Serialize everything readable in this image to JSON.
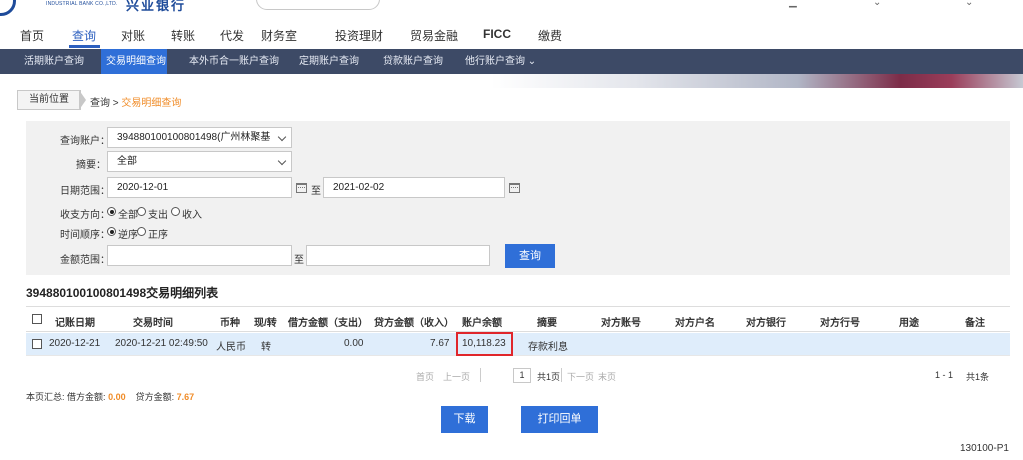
{
  "header": {
    "bank_name_en": "INDUSTRIAL BANK CO.,LTD.",
    "bank_name_cn": "兴业银行",
    "top_icons": [
      "user-icon",
      "chevron-down-icon",
      "help-icon"
    ]
  },
  "main_nav": {
    "items": [
      "首页",
      "查询",
      "对账",
      "转账",
      "代发",
      "财务室",
      "投资理财",
      "贸易金融",
      "FICC",
      "缴费"
    ],
    "active": "查询"
  },
  "sub_nav": {
    "items": [
      "活期账户查询",
      "交易明细查询",
      "本外币合一账户查询",
      "定期账户查询",
      "贷款账户查询",
      "他行账户查询"
    ],
    "active": "交易明细查询"
  },
  "breadcrumb": {
    "label": "当前位置",
    "path": "查询 > ",
    "current": "交易明细查询"
  },
  "query": {
    "account_label": "查询账户：",
    "account_value": "394880100100801498(广州林聚基",
    "summary_label": "摘要：",
    "summary_value": "全部",
    "date_label": "日期范围：",
    "date_from": "2020-12-01",
    "date_to_sep": "至",
    "date_to": "2021-02-02",
    "direction_label": "收支方向：",
    "direction_options": [
      "全部",
      "支出",
      "收入"
    ],
    "direction_selected": "全部",
    "order_label": "时间顺序：",
    "order_options": [
      "逆序",
      "正序"
    ],
    "order_selected": "逆序",
    "amount_label": "金额范围：",
    "amount_from": "",
    "amount_to_sep": "至",
    "amount_to": "",
    "submit_label": "查询"
  },
  "list": {
    "title": "394880100100801498交易明细列表",
    "columns": [
      "记账日期",
      "交易时间",
      "币种",
      "现/转",
      "借方金额（支出）",
      "贷方金额（收入）",
      "账户余额",
      "摘要",
      "对方账号",
      "对方户名",
      "对方银行",
      "对方行号",
      "用途",
      "备注"
    ],
    "rows": [
      {
        "date": "2020-12-21",
        "time": "2020-12-21 02:49:50",
        "currency": "人民币",
        "cash_transfer": "转",
        "debit": "0.00",
        "credit": "7.67",
        "balance": "10,118.23",
        "summary": "存款利息",
        "counter_account": "",
        "counter_name": "",
        "counter_bank": "",
        "counter_bank_no": "",
        "purpose": "",
        "remark": ""
      }
    ]
  },
  "pager": {
    "first": "首页",
    "prev": "上一页",
    "page": "1",
    "total_pages": "共1页",
    "next": "下一页",
    "last": "末页",
    "range": "1 - 1",
    "total": "共1条"
  },
  "page_summary": {
    "label": "本页汇总:",
    "debit_label": "借方金额:",
    "debit_value": "0.00",
    "credit_label": "贷方金额:",
    "credit_value": "7.67"
  },
  "actions": {
    "download": "下载",
    "print_receipt": "打印回单"
  },
  "footer_code": "130100-P1",
  "colors": {
    "accent": "#2f6fd8",
    "subnav_bg": "#3d4a66",
    "highlight_orange": "#f08c28",
    "row_highlight": "#dfedfb",
    "annotation_red": "#e0262b"
  }
}
